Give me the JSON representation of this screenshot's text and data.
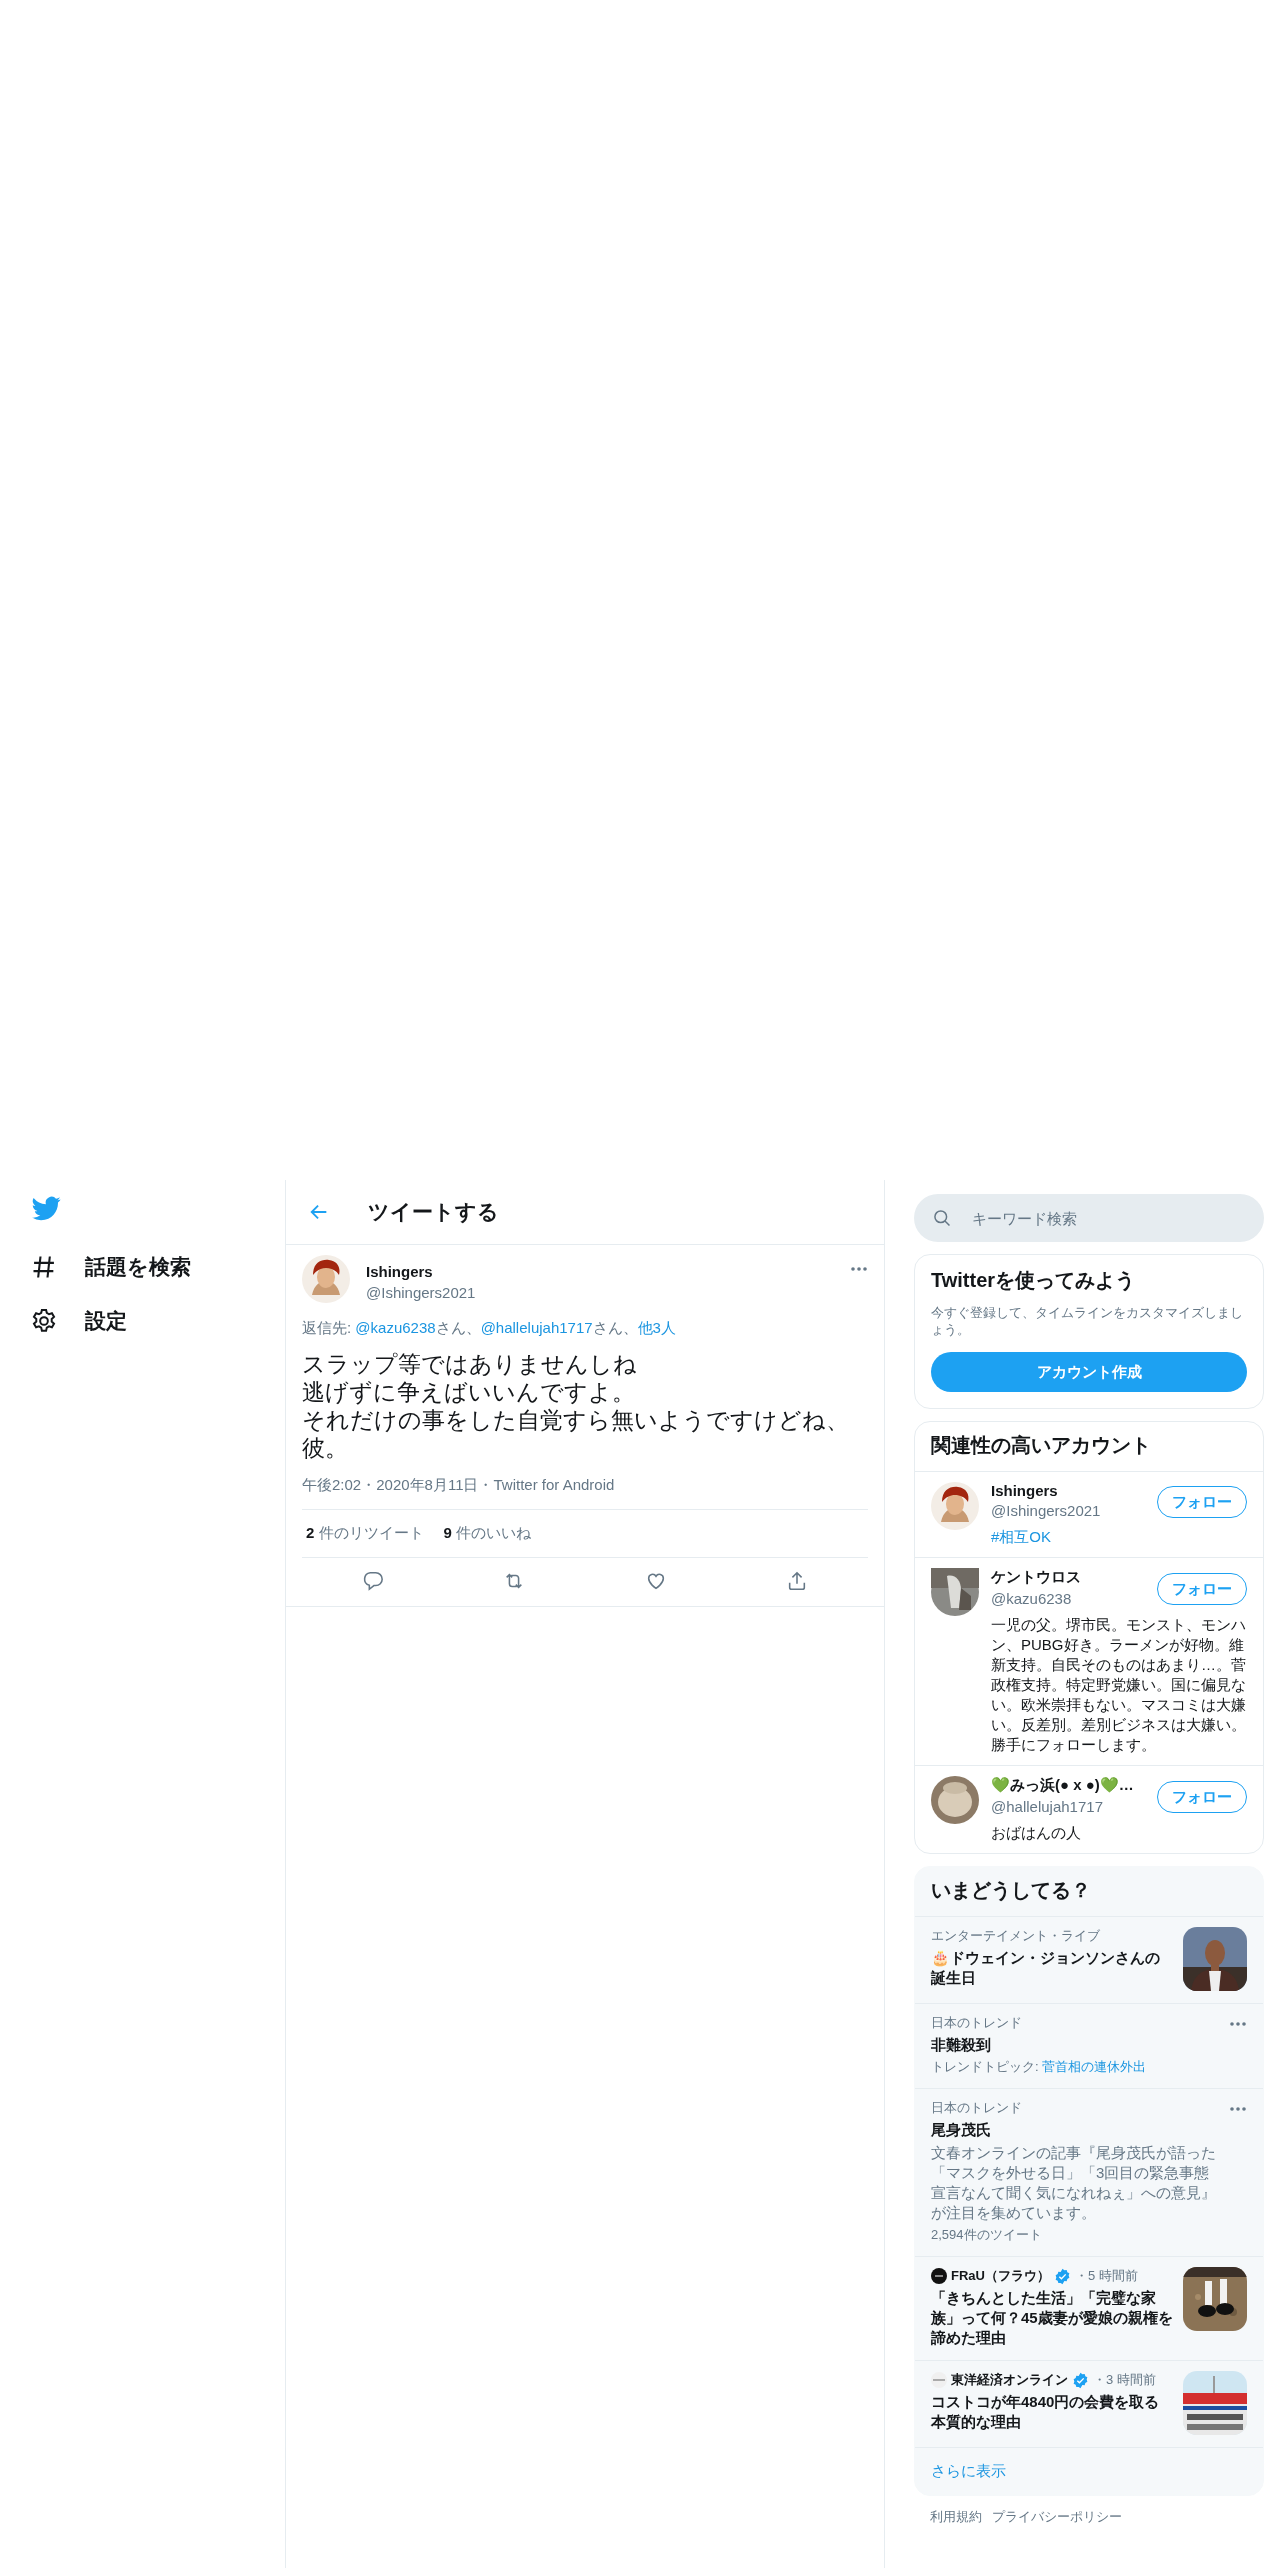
{
  "nav": {
    "items": [
      {
        "label": "話題を検索"
      },
      {
        "label": "設定"
      }
    ]
  },
  "header": {
    "title": "ツイートする"
  },
  "tweet": {
    "name": "Ishingers",
    "handle": "@Ishingers2021",
    "reply_to": [
      {
        "kind": "text",
        "text": "返信先: "
      },
      {
        "kind": "link",
        "text": "@kazu6238"
      },
      {
        "kind": "text",
        "text": "さん、"
      },
      {
        "kind": "link",
        "text": "@hallelujah1717"
      },
      {
        "kind": "text",
        "text": "さん、"
      },
      {
        "kind": "link",
        "text": "他3人"
      }
    ],
    "lines": [
      "スラップ等ではありませんしね",
      "逃げずに争えばいいんですよ。",
      "それだけの事をした自覚すら無いようですけどね、",
      "彼。"
    ],
    "meta": "午後2:02・2020年8月11日・Twitter for Android",
    "stats": [
      {
        "count": "2",
        "label": " 件のリツイート"
      },
      {
        "count": "9",
        "label": " 件のいいね"
      }
    ]
  },
  "search": {
    "placeholder": "キーワード検索"
  },
  "signup": {
    "title": "Twitterを使ってみよう",
    "description": "今すぐ登録して、タイムラインをカスタマイズしましょう。",
    "button": "アカウント作成"
  },
  "who_to_follow": {
    "title": "関連性の高いアカウント",
    "accounts": [
      {
        "name": "Ishingers",
        "handle": "@Ishingers2021",
        "bio": {
          "kind": "hashtag",
          "text": "#相互OK"
        },
        "button": "フォロー"
      },
      {
        "name": "ケントウロス",
        "handle": "@kazu6238",
        "bio": {
          "kind": "plain",
          "text": "一児の父。堺市民。モンスト、モンハン、PUBG好き。ラーメンが好物。維新支持。自民そのものはあまり…。菅政権支持。特定野党嫌い。国に偏見ない。欧米崇拝もない。マスコミは大嫌い。反差別。差別ビジネスは大嫌い。勝手にフォローします。"
        },
        "button": "フォロー"
      },
      {
        "name": "💚みっ浜(● x ●)💚…",
        "handle": "@hallelujah1717",
        "bio": {
          "kind": "plain",
          "text": "おばはんの人"
        },
        "button": "フォロー"
      }
    ]
  },
  "trends": {
    "title": "いまどうしてる？",
    "items": [
      {
        "kind": "event",
        "category": "エンターテイメント・ライブ",
        "title": "🎂ドウェイン・ジョンソンさんの誕生日"
      },
      {
        "kind": "trend",
        "category": "日本のトレンド",
        "title": "非難殺到",
        "topic_label": "トレンドトピック: ",
        "topic": "菅首相の連休外出"
      },
      {
        "kind": "trend",
        "category": "日本のトレンド",
        "title": "尾身茂氏",
        "description": "文春オンラインの記事『尾身茂氏が語った「マスクを外せる日」「3回目の緊急事態宣言なんて聞く気になれねぇ」への意見』が注目を集めています。",
        "count": "2,594件のツイート"
      },
      {
        "kind": "article",
        "source": "FRaU（フラウ）",
        "verified": true,
        "time": "・5 時間前",
        "title": "「きちんとした生活」「完璧な家族」って何？45歳妻が愛娘の親権を諦めた理由"
      },
      {
        "kind": "article",
        "source": "東洋経済オンライン",
        "verified": true,
        "time": "・3 時間前",
        "title": "コストコが年4840円の会費を取る本質的な理由"
      }
    ],
    "show_more": "さらに表示"
  },
  "footer": {
    "links": [
      "利用規約",
      "プライバシーポリシー"
    ]
  }
}
